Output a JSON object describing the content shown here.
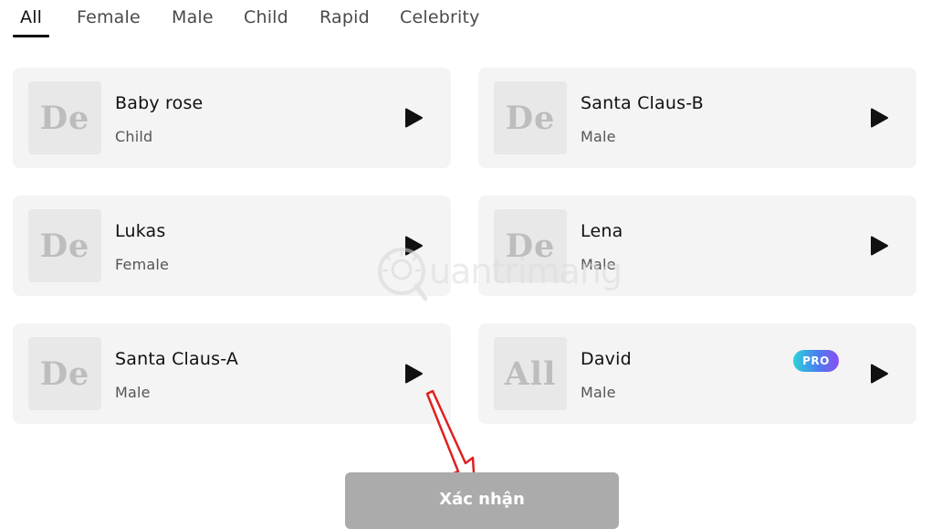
{
  "tabs": [
    {
      "label": "All",
      "active": true
    },
    {
      "label": "Female",
      "active": false
    },
    {
      "label": "Male",
      "active": false
    },
    {
      "label": "Child",
      "active": false
    },
    {
      "label": "Rapid",
      "active": false
    },
    {
      "label": "Celebrity",
      "active": false
    }
  ],
  "voices": [
    {
      "avatar_text": "De",
      "name": "Baby rose",
      "category": "Child",
      "pro": false
    },
    {
      "avatar_text": "De",
      "name": "Santa Claus-B",
      "category": "Male",
      "pro": false
    },
    {
      "avatar_text": "De",
      "name": "Lukas",
      "category": "Female",
      "pro": false
    },
    {
      "avatar_text": "De",
      "name": "Lena",
      "category": "Male",
      "pro": false
    },
    {
      "avatar_text": "De",
      "name": "Santa Claus-A",
      "category": "Male",
      "pro": false
    },
    {
      "avatar_text": "All",
      "name": "David",
      "category": "Male",
      "pro": true,
      "pro_label": "PRO"
    }
  ],
  "confirm_button": {
    "label": "Xác nhận"
  },
  "watermark": {
    "text": "uantrimang"
  },
  "colors": {
    "card_bg": "#f4f4f4",
    "confirm_bg": "#ababab",
    "arrow": "#e02020",
    "pro_gradient_start": "#2bd3d8",
    "pro_gradient_end": "#8a4ef2"
  },
  "icons": {
    "play": "play-triangle-icon",
    "annotation": "red-arrow-icon",
    "watermark_logo": "lightbulb-logo-icon"
  }
}
